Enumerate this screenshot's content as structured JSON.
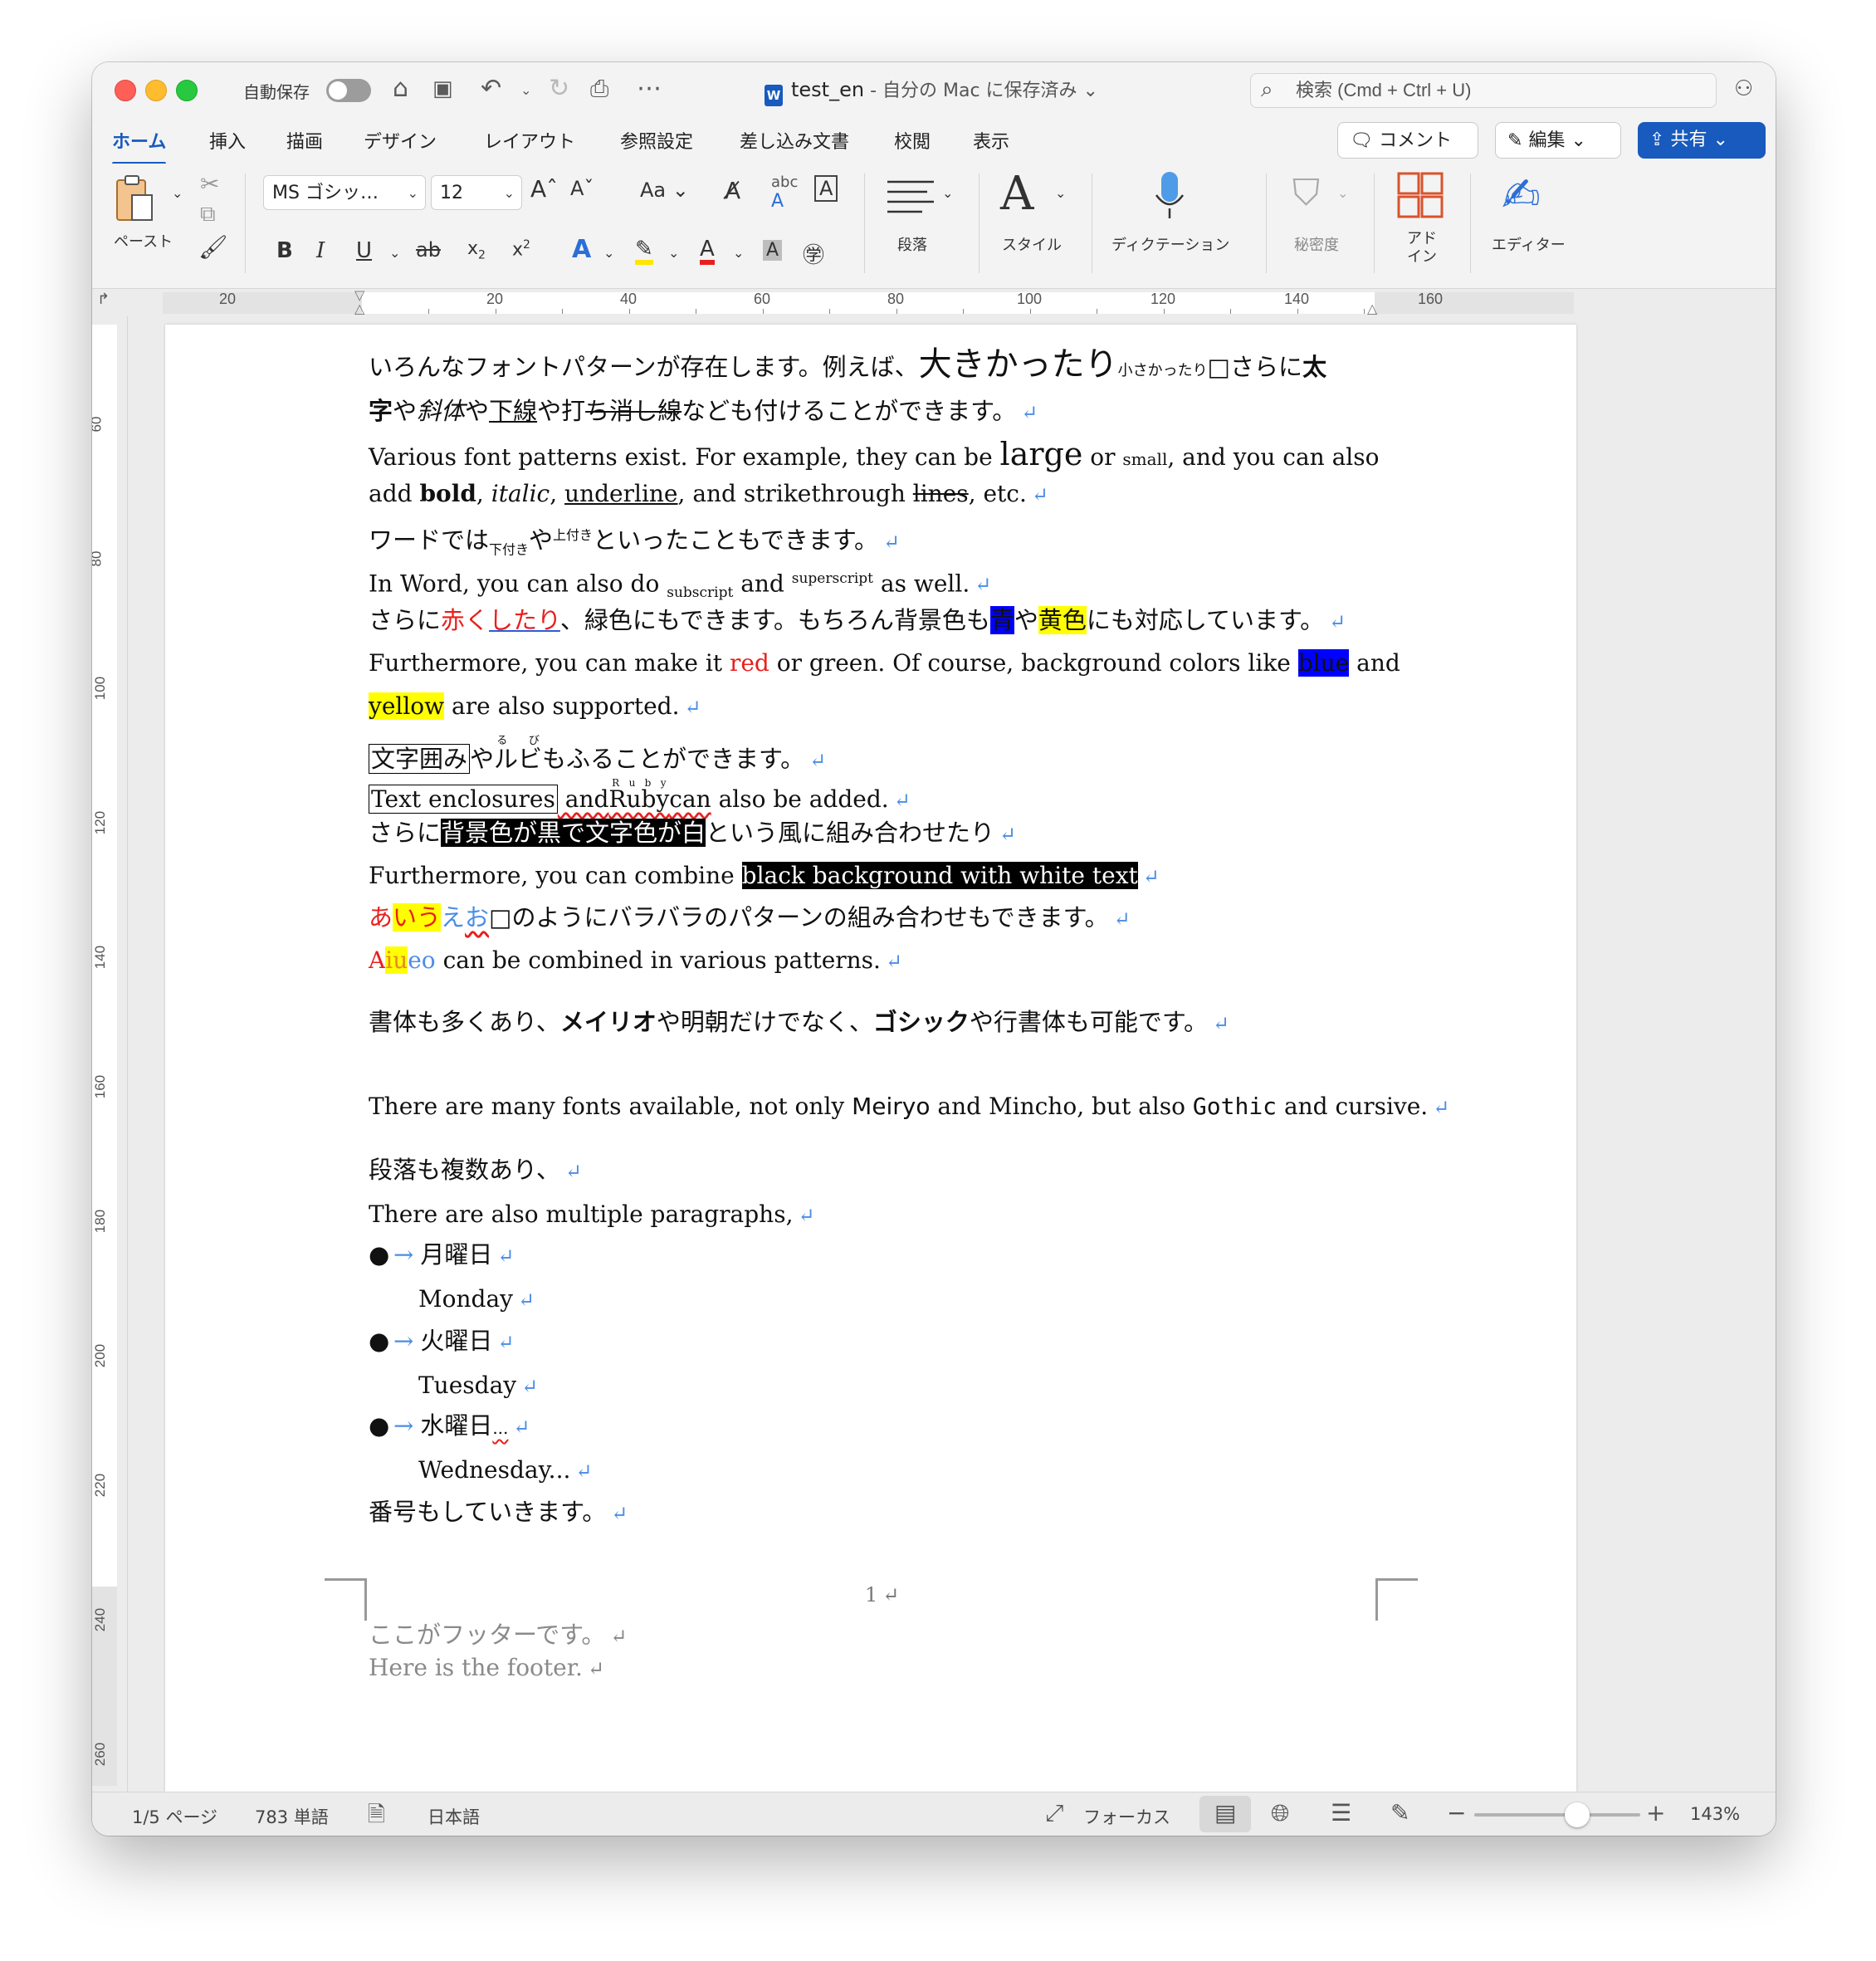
{
  "titlebar": {
    "autosave_label": "自動保存",
    "doc_name": "test_en",
    "doc_location": " - 自分の Mac に保存済み",
    "search_placeholder": "検索 (Cmd + Ctrl + U)"
  },
  "tabs": [
    "ホーム",
    "挿入",
    "描画",
    "デザイン",
    "レイアウト",
    "参照設定",
    "差し込み文書",
    "校閲",
    "表示"
  ],
  "actions": {
    "comment": "コメント",
    "edit": "編集",
    "share": "共有"
  },
  "ribbon": {
    "paste": "ペースト",
    "font_name": "MS ゴシッ…",
    "font_size": "12",
    "paragraph": "段落",
    "styles": "スタイル",
    "dictation": "ディクテーション",
    "sensitivity": "秘密度",
    "addin_1": "アド",
    "addin_2": "イン",
    "editor": "エディター"
  },
  "ruler": {
    "labels": [
      "20",
      "20",
      "40",
      "60",
      "80",
      "100",
      "120",
      "140",
      "160"
    ]
  },
  "vruler": {
    "labels": [
      "60",
      "80",
      "100",
      "120",
      "140",
      "160",
      "180",
      "200",
      "220",
      "240",
      "260"
    ]
  },
  "doc": {
    "l1a": "いろんなフォントパターンが存在します。例えば、",
    "l1b": "大きかったり",
    "l1c": "小さかったり",
    "l1d": "□さらに",
    "l1e": "太",
    "l2a": "字",
    "l2b": "や",
    "l2c": "斜体",
    "l2d": "や",
    "l2e": "下線",
    "l2f": "や打",
    "l2g": "ち消し線",
    "l2h": "なども付けることができます。",
    "l3a": "Various font patterns exist. For example, they can be ",
    "l3b": "large",
    "l3c": " or ",
    "l3d": "small",
    "l3e": ", and you can also",
    "l4a": "add ",
    "l4b": "bold",
    "l4c": ", ",
    "l4d": "italic",
    "l4e": ", ",
    "l4f": "underline",
    "l4g": ", and strikethrough ",
    "l4h": "lines",
    "l4i": ", etc.",
    "l5a": "ワードでは",
    "l5b": "下付き",
    "l5c": "や",
    "l5d": "上付き",
    "l5e": "といったこともできます。",
    "l6a": "In Word, you can also do ",
    "l6b": "subscript",
    "l6c": " and ",
    "l6d": "superscript",
    "l6e": " as well.",
    "l7a": "さらに",
    "l7b": "赤く",
    "l7c": "したり",
    "l7d": "、緑色にもできます。もちろん背景色も",
    "l7e": "青",
    "l7f": "や",
    "l7g": "黄色",
    "l7h": "にも対応しています。",
    "l8a": "Furthermore, you can make it ",
    "l8b": "red",
    "l8c": " or green. Of course, background colors like ",
    "l8d": "blue",
    "l8e": " and",
    "l9a": "yellow",
    "l9b": " are also supported.",
    "l10a": "文字囲み",
    "l10b": "や",
    "l10c": "ルビ",
    "l10r": "る　び",
    "l10d": "もふることができます。",
    "l11a": "Text enclosures",
    "l11b": " and",
    "l11c": "Ruby",
    "l11r": "R u b y",
    "l11d": "can",
    "l11e": " also be added.",
    "l12a": "さらに",
    "l12b": "背景色が黒で文字色が白",
    "l12c": "という風に組み合わせたり",
    "l13a": "Furthermore, you can combine ",
    "l13b": "black background with white text",
    "l14a": "あ",
    "l14b": "いう",
    "l14c": "え",
    "l14d": "お",
    "l14e": "□のようにバラバラのパターンの組み合わせもできます。",
    "l15a": "A",
    "l15b": "iu",
    "l15c": "eo",
    "l15d": " can be combined in various patterns.",
    "l16a": "書体も多くあり、",
    "l16b": "メイリオ",
    "l16c": "や明朝だけでなく、",
    "l16d": "ゴシック",
    "l16e": "や行書体も可能です。",
    "l17a": "There are many fonts available, not only ",
    "l17b": "Meiryo",
    "l17c": " and Mincho, but also ",
    "l17d": "Gothic",
    "l17e": " and cursive.",
    "l18": "段落も複数あり、",
    "l19": "There are also multiple paragraphs,",
    "l20": "月曜日",
    "l21": "Monday",
    "l22": "火曜日",
    "l23": "Tuesday",
    "l24a": "水曜日",
    "l24b": "...",
    "l25": "Wednesday...",
    "l26": "番号もしていきます。",
    "page_num": "1",
    "footer1": "ここがフッターです。",
    "footer2": "Here is the footer."
  },
  "status": {
    "page": "1/5 ページ",
    "words": "783 単語",
    "language": "日本語",
    "focus": "フォーカス",
    "zoom": "143%",
    "zoom_level": 0.62
  },
  "colors": {
    "accent": "#185abd",
    "return_mark": "#4b8ee6",
    "red_text": "#e8201d",
    "highlight_yellow": "#ffff00",
    "highlight_blue": "#0000ff"
  }
}
